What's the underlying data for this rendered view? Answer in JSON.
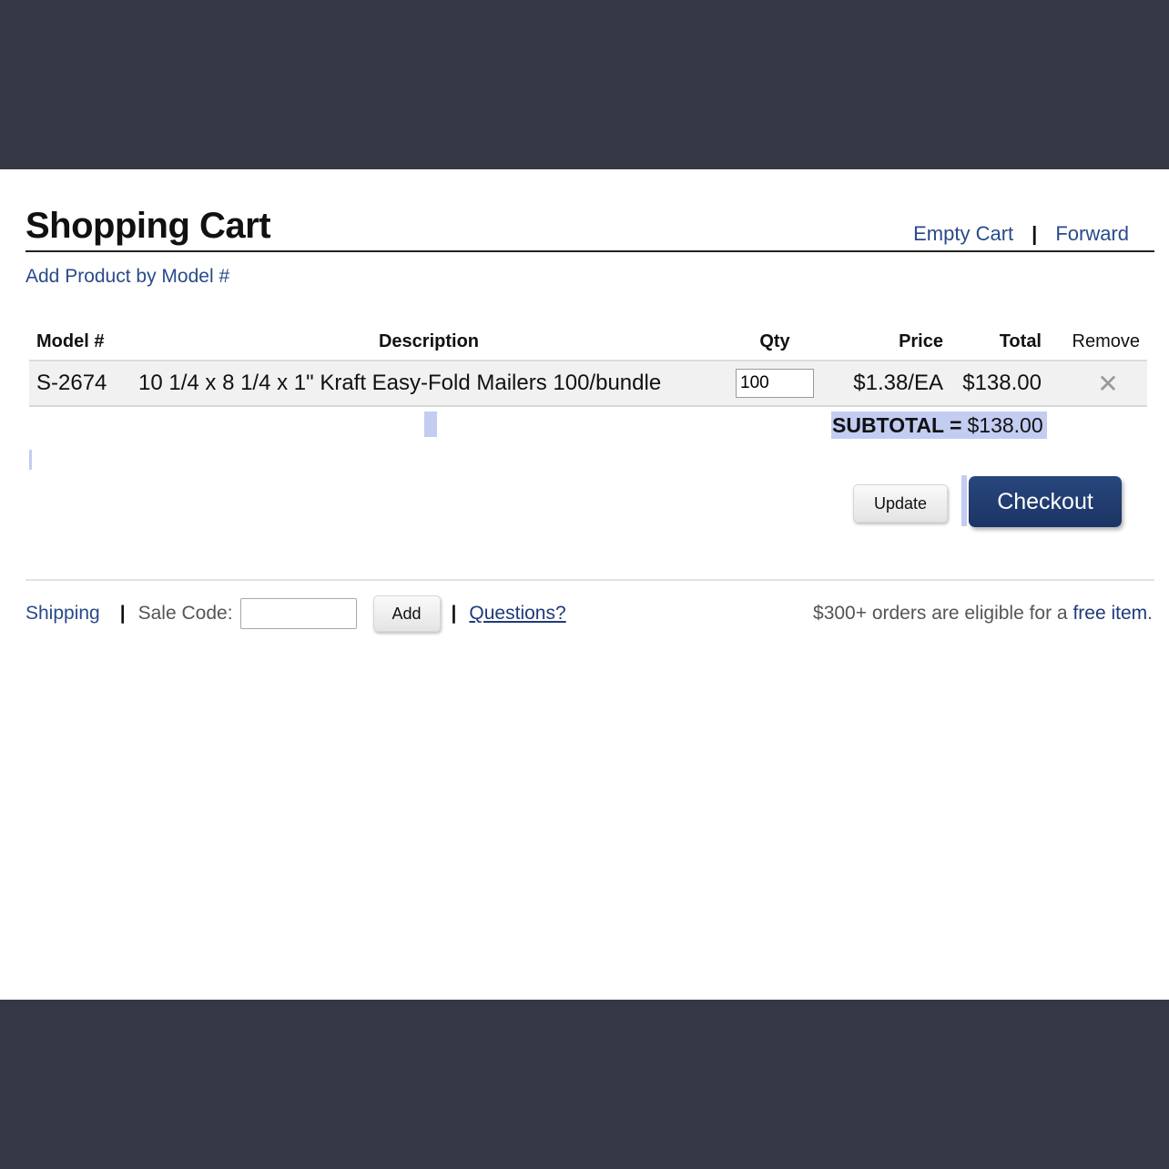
{
  "header": {
    "title": "Shopping Cart",
    "empty_cart": "Empty Cart",
    "separator": "|",
    "forward": "Forward",
    "add_product": "Add Product by Model #"
  },
  "table": {
    "columns": [
      "Model #",
      "Description",
      "Qty",
      "Price",
      "Total",
      "Remove"
    ],
    "rows": [
      {
        "model": "S-2674",
        "description": "10 1/4 x 8 1/4 x 1\" Kraft Easy-Fold Mailers 100/bundle",
        "qty": "100",
        "price": "$1.38/EA",
        "total": "$138.00",
        "remove_glyph": "✕"
      }
    ]
  },
  "subtotal": {
    "label": "SUBTOTAL =",
    "value": "$138.00"
  },
  "buttons": {
    "update": "Update",
    "checkout": "Checkout"
  },
  "footer": {
    "shipping": "Shipping",
    "separator": "|",
    "sale_code_label": "Sale Code:",
    "sale_code_value": "",
    "add": "Add",
    "questions": "Questions?",
    "promo_prefix": "$300+ orders are eligible for a",
    "promo_link": "free item",
    "promo_suffix": "."
  },
  "colors": {
    "frame": "#363845",
    "link": "#2a4a8a",
    "checkout_bg": "#1b3463",
    "selection": "#c3cdf2"
  }
}
